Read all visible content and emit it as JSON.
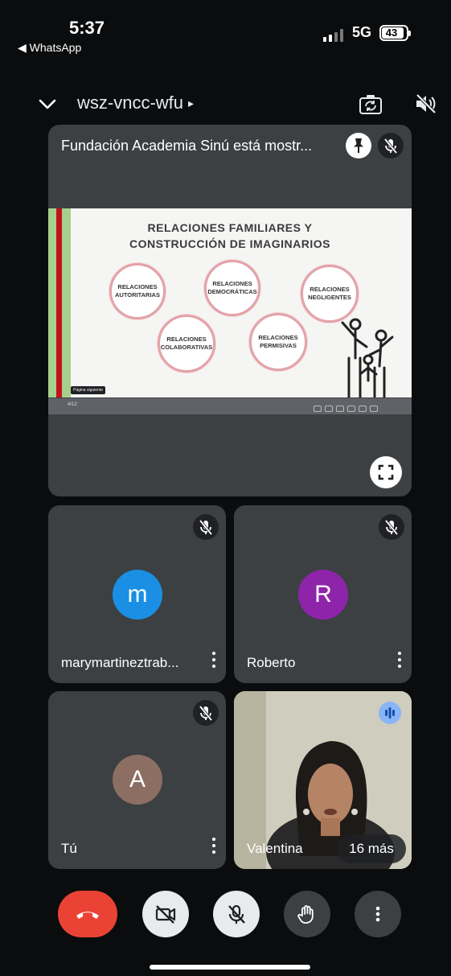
{
  "status_bar": {
    "time": "5:37",
    "back_app": "◀ WhatsApp",
    "network": "5G",
    "battery": "43"
  },
  "header": {
    "meeting_code": "wsz-vncc-wfu",
    "code_arrow": "▸"
  },
  "presentation": {
    "title": "Fundación Academia Sinú está mostr...",
    "slide": {
      "title_line1": "RELACIONES FAMILIARES Y",
      "title_line2": "CONSTRUCCIÓN DE IMAGINARIOS",
      "bubbles": [
        "RELACIONES AUTORITARIAS",
        "RELACIONES DEMOCRÁTICAS",
        "RELACIONES NEGLIGENTES",
        "RELACIONES COLABORATIVAS",
        "RELACIONES PERMISIVAS"
      ],
      "page_indicator": "4/12",
      "next_hint": "Página siguiente"
    }
  },
  "participants": [
    {
      "name": "marymartineztrab...",
      "initial": "m",
      "avatar_color": "#1a8fe3",
      "muted": true
    },
    {
      "name": "Roberto",
      "initial": "R",
      "avatar_color": "#8e24aa",
      "muted": true
    },
    {
      "name": "Tú",
      "initial": "A",
      "avatar_color": "#8d6e63",
      "muted": true
    },
    {
      "name": "Valentina",
      "video": true,
      "speaking": true
    }
  ],
  "others": "16 más",
  "controls": {
    "end_call": "end-call",
    "camera": "camera-off",
    "mic": "mic-off",
    "raise_hand": "raise-hand",
    "more": "more-options"
  },
  "colors": {
    "end_call": "#ea4335",
    "tile_bg": "#3c4043",
    "speaking_badge": "#8ab4f8"
  }
}
